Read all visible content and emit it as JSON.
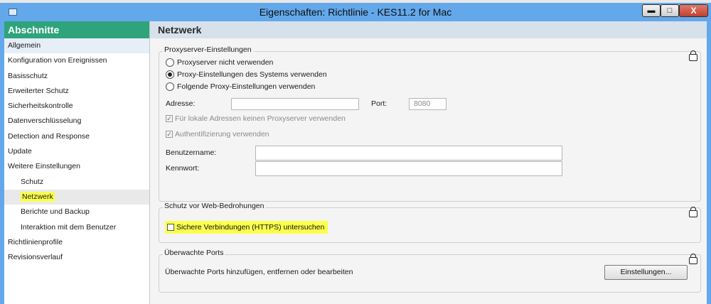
{
  "window": {
    "title": "Eigenschaften: Richtlinie - KES11.2 for Mac",
    "buttons": {
      "minimize": "▬",
      "maximize": "□",
      "close": "X"
    }
  },
  "sidebar": {
    "header": "Abschnitte",
    "items": [
      {
        "label": "Allgemein",
        "level": 0,
        "state": "selected"
      },
      {
        "label": "Konfiguration von Ereignissen",
        "level": 0
      },
      {
        "label": "Basisschutz",
        "level": 0
      },
      {
        "label": "Erweiterter Schutz",
        "level": 0
      },
      {
        "label": "Sicherheitskontrolle",
        "level": 0
      },
      {
        "label": "Datenverschlüsselung",
        "level": 0
      },
      {
        "label": "Detection and Response",
        "level": 0
      },
      {
        "label": "Update",
        "level": 0
      },
      {
        "label": "Weitere Einstellungen",
        "level": 0
      },
      {
        "label": "Schutz",
        "level": 1
      },
      {
        "label": "Netzwerk",
        "level": 1,
        "state": "active"
      },
      {
        "label": "Berichte und Backup",
        "level": 1
      },
      {
        "label": "Interaktion mit dem Benutzer",
        "level": 1
      },
      {
        "label": "Richtlinienprofile",
        "level": 0
      },
      {
        "label": "Revisionsverlauf",
        "level": 0
      }
    ]
  },
  "main": {
    "title": "Netzwerk",
    "proxy": {
      "title": "Proxyserver-Einstellungen",
      "radio_none": "Proxyserver nicht verwenden",
      "radio_system": "Proxy-Einstellungen des Systems verwenden",
      "radio_custom": "Folgende Proxy-Einstellungen verwenden",
      "selected_radio": "system",
      "address_label": "Adresse:",
      "address_value": "",
      "port_label": "Port:",
      "port_value": "8080",
      "bypass_local_label": "Für lokale Adressen keinen Proxyserver verwenden",
      "bypass_local_checked": true,
      "auth_label": "Authentifizierung verwenden",
      "auth_checked": true,
      "username_label": "Benutzername:",
      "username_value": "",
      "password_label": "Kennwort:",
      "password_value": ""
    },
    "web_threats": {
      "title": "Schutz vor Web-Bedrohungen",
      "https_scan_label": "Sichere Verbindungen (HTTPS) untersuchen",
      "https_scan_checked": false
    },
    "ports": {
      "title": "Überwachte Ports",
      "description": "Überwachte Ports hinzufügen, entfernen oder bearbeiten",
      "settings_button": "Einstellungen..."
    }
  },
  "colors": {
    "title_bar": "#63a8ea",
    "sidebar_header": "#2fa37c",
    "section_header": "#d6e1ec",
    "highlight": "#fbff4d"
  }
}
